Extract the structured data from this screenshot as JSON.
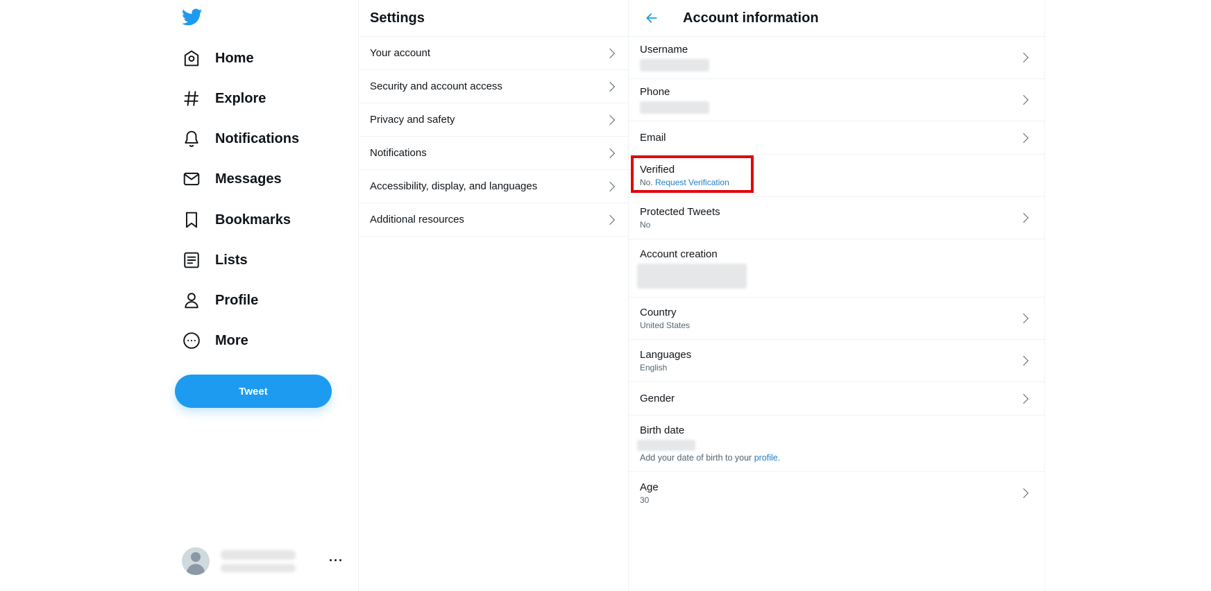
{
  "nav": {
    "items": [
      {
        "label": "Home",
        "icon": "home-icon"
      },
      {
        "label": "Explore",
        "icon": "hashtag-icon"
      },
      {
        "label": "Notifications",
        "icon": "bell-icon"
      },
      {
        "label": "Messages",
        "icon": "envelope-icon"
      },
      {
        "label": "Bookmarks",
        "icon": "bookmark-icon"
      },
      {
        "label": "Lists",
        "icon": "list-icon"
      },
      {
        "label": "Profile",
        "icon": "person-icon"
      },
      {
        "label": "More",
        "icon": "more-circle-icon"
      }
    ],
    "tweet_label": "Tweet",
    "account_more": "···"
  },
  "settings": {
    "title": "Settings",
    "items": [
      {
        "label": "Your account"
      },
      {
        "label": "Security and account access"
      },
      {
        "label": "Privacy and safety"
      },
      {
        "label": "Notifications"
      },
      {
        "label": "Accessibility, display, and languages"
      },
      {
        "label": "Additional resources"
      }
    ]
  },
  "account_info": {
    "title": "Account information",
    "username": {
      "label": "Username"
    },
    "phone": {
      "label": "Phone"
    },
    "email": {
      "label": "Email"
    },
    "verified": {
      "label": "Verified",
      "value_prefix": "No. ",
      "link": "Request Verification"
    },
    "protected": {
      "label": "Protected Tweets",
      "value": "No"
    },
    "creation": {
      "label": "Account creation"
    },
    "country": {
      "label": "Country",
      "value": "United States"
    },
    "languages": {
      "label": "Languages",
      "value": "English"
    },
    "gender": {
      "label": "Gender"
    },
    "birth": {
      "label": "Birth date",
      "note_prefix": "Add your date of birth to your ",
      "note_link": "profile",
      "note_suffix": "."
    },
    "age": {
      "label": "Age",
      "value": "30"
    }
  },
  "colors": {
    "accent": "#1d9bf0",
    "link": "#1d7fc4",
    "highlight": "#e3000b",
    "divider": "#eff3f4"
  }
}
